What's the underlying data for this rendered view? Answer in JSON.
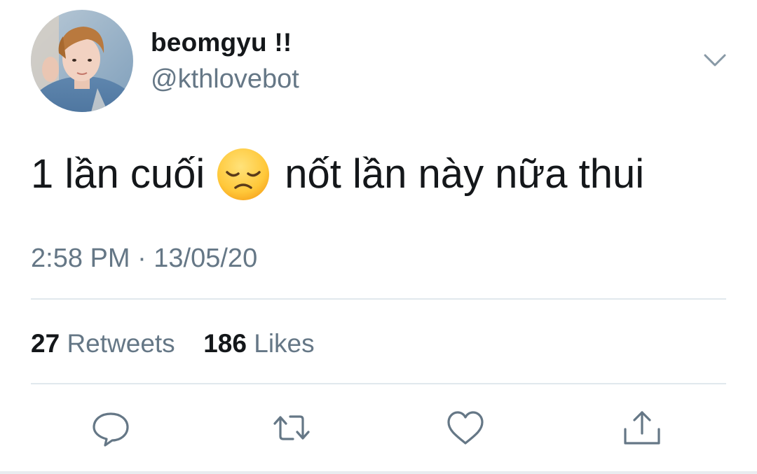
{
  "author": {
    "display_name": "beomgyu !!",
    "handle": "@kthlovebot"
  },
  "tweet": {
    "text_before_emoji": "1 lần cuối",
    "emoji": "disappointed-face",
    "text_after_emoji": "nốt lần này nữa thui",
    "timestamp": "2:58 PM · 13/05/20"
  },
  "stats": {
    "retweets_count": "27",
    "retweets_label": "Retweets",
    "likes_count": "186",
    "likes_label": "Likes"
  },
  "icons": {
    "menu": "chevron-down-icon",
    "reply": "reply-icon",
    "retweet": "retweet-icon",
    "like": "heart-icon",
    "share": "share-icon"
  },
  "colors": {
    "text_primary": "#14171a",
    "text_secondary": "#657786",
    "divider": "#e1e8ed"
  }
}
